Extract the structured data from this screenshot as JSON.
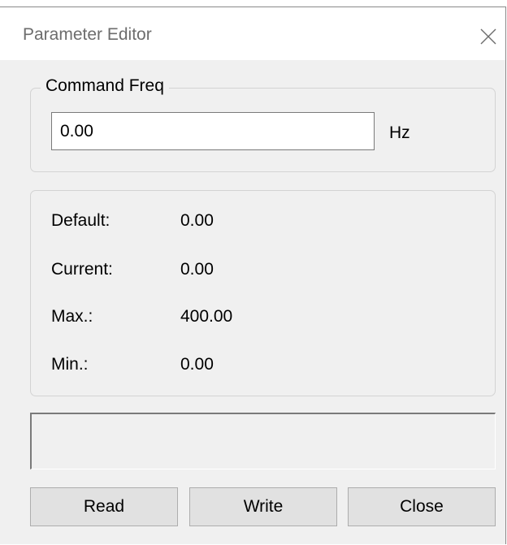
{
  "window": {
    "title": "Parameter Editor",
    "close_icon": "close-icon"
  },
  "command_group": {
    "legend": "Command Freq",
    "value": "0.00",
    "unit": "Hz"
  },
  "info": {
    "default_label": "Default:",
    "default_value": "0.00",
    "current_label": "Current:",
    "current_value": "0.00",
    "max_label": "Max.:",
    "max_value": "400.00",
    "min_label": "Min.:",
    "min_value": "0.00"
  },
  "status": {
    "text": ""
  },
  "buttons": {
    "read": "Read",
    "write": "Write",
    "close": "Close"
  }
}
